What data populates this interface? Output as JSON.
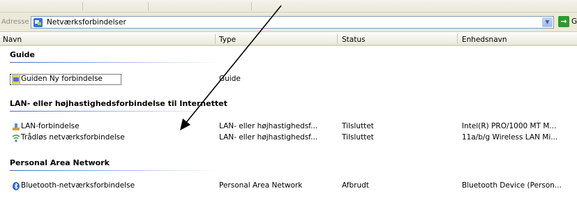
{
  "address_bar": {
    "label": "Adresse",
    "value": "Netværksforbindelser",
    "go_label": "Gå"
  },
  "columns": {
    "name": "Navn",
    "type": "Type",
    "status": "Status",
    "device": "Enhedsnavn"
  },
  "groups": [
    {
      "title": "Guide",
      "items": [
        {
          "name": "Guiden Ny forbindelse",
          "type": "Guide",
          "status": "",
          "device": "",
          "icon": "wizard-icon"
        }
      ]
    },
    {
      "title": "LAN- eller højhastighedsforbindelse til Internettet",
      "items": [
        {
          "name": "LAN-forbindelse",
          "type": "LAN- eller højhastighedsf...",
          "status": "Tilsluttet",
          "device": "Intel(R) PRO/1000 MT M...",
          "icon": "lan-connection-icon"
        },
        {
          "name": "Trådløs netværksforbindelse",
          "type": "LAN- eller højhastighedsf...",
          "status": "Tilsluttet",
          "device": "11a/b/g Wireless LAN Mi...",
          "icon": "wireless-connection-icon"
        }
      ]
    },
    {
      "title": "Personal Area Network",
      "items": [
        {
          "name": "Bluetooth-netværksforbindelse",
          "type": "Personal Area Network",
          "status": "Afbrudt",
          "device": "Bluetooth Device (Person...",
          "icon": "bluetooth-icon"
        }
      ]
    }
  ],
  "colors": {
    "group_line": "#3f66c4",
    "address_border": "#7f9db9",
    "go_green": "#2c9a2c",
    "arrow": "#000000"
  }
}
